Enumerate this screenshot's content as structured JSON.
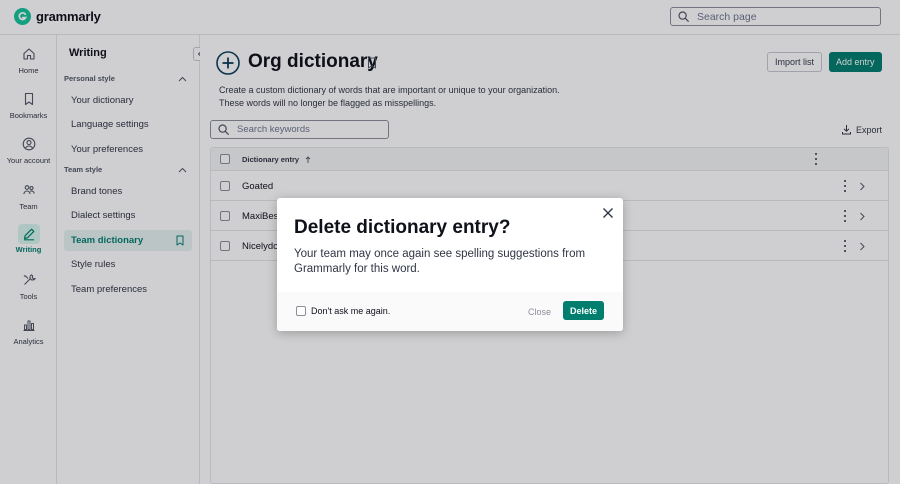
{
  "app": {
    "name": "grammarly"
  },
  "search": {
    "placeholder": "Search page"
  },
  "rail": {
    "items": [
      {
        "label": "Home",
        "icon": "home-icon"
      },
      {
        "label": "Bookmarks",
        "icon": "bookmark-icon"
      },
      {
        "label": "Your account",
        "icon": "account-icon"
      },
      {
        "label": "Team",
        "icon": "team-icon"
      },
      {
        "label": "Writing",
        "icon": "pen-icon",
        "active": true
      },
      {
        "label": "Tools",
        "icon": "tools-icon"
      },
      {
        "label": "Analytics",
        "icon": "analytics-icon"
      }
    ]
  },
  "subnav": {
    "title": "Writing",
    "personal_header": "Personal style",
    "personal_items": [
      "Your dictionary",
      "Language settings",
      "Your preferences"
    ],
    "team_header": "Team style",
    "team_items": [
      "Brand tones",
      "Dialect settings",
      "Team dictionary",
      "Style rules",
      "Team preferences"
    ],
    "active_item": "Team dictionary"
  },
  "main": {
    "title": "Org dictionary",
    "import_label": "Import list",
    "add_label": "Add entry",
    "description_line1": "Create a custom dictionary of words that are important or unique to your organization.",
    "description_line2": "These words will no longer be flagged as misspellings.",
    "keyword_placeholder": "Search keywords",
    "export_label": "Export",
    "table": {
      "column_header": "Dictionary entry",
      "sort": "ascending",
      "rows": [
        "Goated",
        "MaxiBest",
        "Nicelydone"
      ]
    }
  },
  "modal": {
    "title": "Delete dictionary entry?",
    "body": "Your team may once again see spelling suggestions from Grammarly for this word.",
    "dont_ask_label": "Don't ask me again.",
    "dont_ask_checked": false,
    "close_label": "Close",
    "delete_label": "Delete"
  },
  "colors": {
    "accent": "#027e6f",
    "brand": "#15c39a",
    "active_bg": "#e7f3f1",
    "overlay": "rgba(14,16,26,0.2)"
  }
}
